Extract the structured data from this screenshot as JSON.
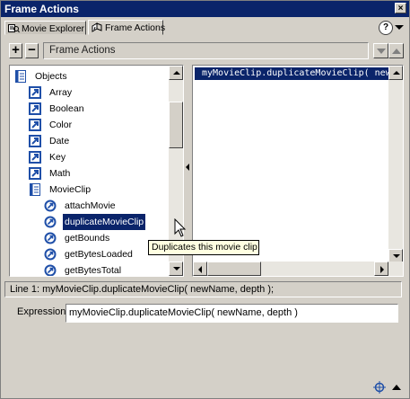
{
  "window": {
    "title": "Frame Actions",
    "close_glyph": "×"
  },
  "tabs": [
    {
      "label": "Movie Explorer",
      "icon": "movie-explorer-icon",
      "active": false
    },
    {
      "label": "Frame Actions",
      "icon": "frame-actions-icon",
      "active": true
    }
  ],
  "header": {
    "help_glyph": "?"
  },
  "toolbar": {
    "plus_glyph": "+",
    "minus_glyph": "−",
    "mode_label": "Frame Actions"
  },
  "tree": {
    "items": [
      {
        "label": "Objects",
        "kind": "book"
      },
      {
        "label": "Array",
        "kind": "object"
      },
      {
        "label": "Boolean",
        "kind": "object"
      },
      {
        "label": "Color",
        "kind": "object"
      },
      {
        "label": "Date",
        "kind": "object"
      },
      {
        "label": "Key",
        "kind": "object"
      },
      {
        "label": "Math",
        "kind": "object"
      },
      {
        "label": "MovieClip",
        "kind": "book"
      },
      {
        "label": "attachMovie",
        "kind": "method"
      },
      {
        "label": "duplicateMovieClip",
        "kind": "method",
        "selected": true
      },
      {
        "label": "getBounds",
        "kind": "method"
      },
      {
        "label": "getBytesLoaded",
        "kind": "method"
      },
      {
        "label": "getBytesTotal",
        "kind": "method"
      }
    ]
  },
  "code": {
    "lines": [
      "myMovieClip.duplicateMovieClip( newNam"
    ]
  },
  "tooltip": {
    "text": "Duplicates this movie clip"
  },
  "status": {
    "text": "Line 1: myMovieClip.duplicateMovieClip( newName, depth );"
  },
  "expression": {
    "label": "Expression:",
    "value": "myMovieClip.duplicateMovieClip( newName, depth )"
  },
  "colors": {
    "selection": "#0a246a",
    "icon_blue": "#1f4fa8",
    "tooltip_bg": "#ffffe1",
    "chrome": "#d4d0c8"
  }
}
